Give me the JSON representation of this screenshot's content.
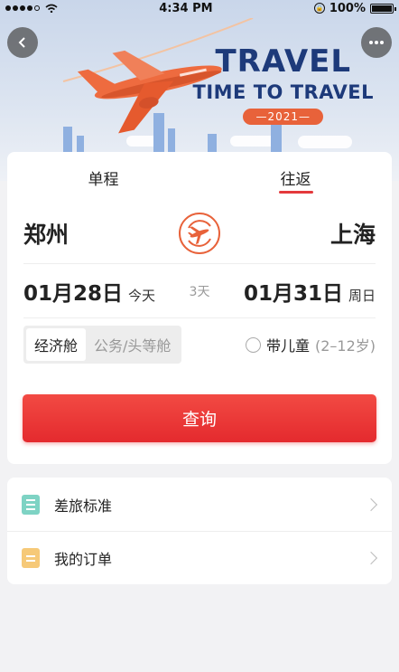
{
  "status_bar": {
    "time": "4:34 PM",
    "battery": "100%"
  },
  "banner": {
    "headline": "TRAVEL",
    "subline": "TIME TO TRAVEL",
    "year": "—2021—"
  },
  "tabs": [
    {
      "label": "单程",
      "active": false
    },
    {
      "label": "往返",
      "active": true
    }
  ],
  "route": {
    "from": "郑州",
    "to": "上海"
  },
  "dates": {
    "depart_date": "01月28日",
    "depart_day": "今天",
    "nights": "3天",
    "return_date": "01月31日",
    "return_day": "周日"
  },
  "cabin": {
    "options": [
      {
        "label": "经济舱",
        "selected": true
      },
      {
        "label": "公务/头等舱",
        "selected": false
      }
    ],
    "child_label": "带儿童",
    "child_range": "(2–12岁)"
  },
  "search_label": "查询",
  "menu": [
    {
      "label": "差旅标准",
      "icon": "travel-standard-icon",
      "color": "#7ed3c4"
    },
    {
      "label": "我的订单",
      "icon": "my-orders-icon",
      "color": "#f6c978"
    }
  ],
  "colors": {
    "accent": "#e4393c",
    "plane": "#e8623a",
    "banner_text": "#1d3a7a"
  }
}
